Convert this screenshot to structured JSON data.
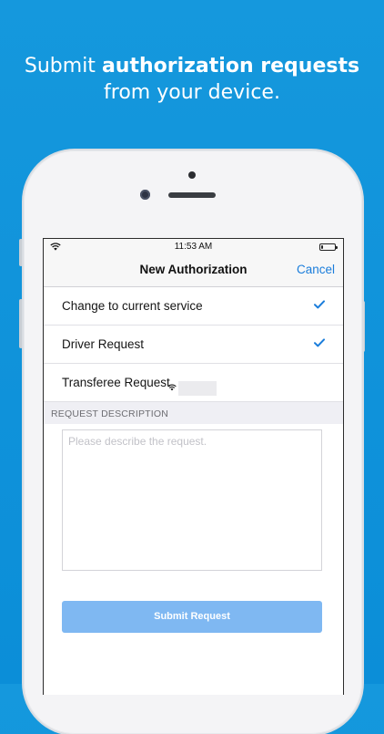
{
  "headline": {
    "prefix": "Submit ",
    "bold": "authorization requests",
    "line2": "from your device."
  },
  "status": {
    "time": "11:53 AM",
    "battery_level": 0.15
  },
  "navbar": {
    "title": "New Authorization",
    "cancel_label": "Cancel"
  },
  "options": [
    {
      "label": "Change to current service",
      "checked": true
    },
    {
      "label": "Driver Request",
      "checked": true
    },
    {
      "label": "Transferee Request",
      "checked": false
    }
  ],
  "section": {
    "header": "REQUEST DESCRIPTION"
  },
  "description": {
    "placeholder": "Please describe the request.",
    "value": ""
  },
  "submit": {
    "label": "Submit Request"
  },
  "colors": {
    "background": "#0b8ed8",
    "accent": "#1a7ddb",
    "submit_disabled": "#7fb8f2"
  },
  "icons": [
    "wifi-icon",
    "battery-icon",
    "checkmark-icon",
    "camera-icon",
    "speaker-icon"
  ]
}
